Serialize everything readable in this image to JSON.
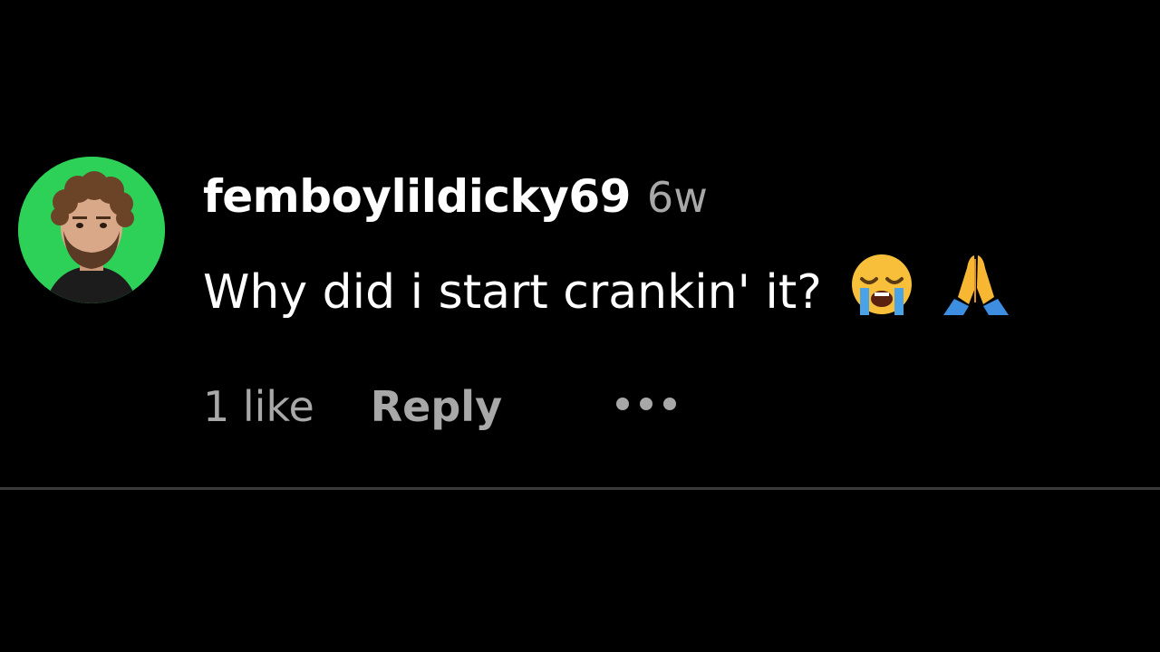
{
  "comment": {
    "username": "femboylildicky69",
    "timestamp": "6w",
    "text": "Why did i start crankin' it?",
    "emojis": [
      "loudly-crying-face-emoji",
      "folded-hands-emoji"
    ],
    "likes_label": "1 like",
    "reply_label": "Reply",
    "more_icon": "more-options-icon"
  },
  "colors": {
    "background": "#000000",
    "username": "#ffffff",
    "secondary_text": "#a8a8a8",
    "avatar_background": "#2ed158",
    "divider": "#3a3a3a"
  }
}
